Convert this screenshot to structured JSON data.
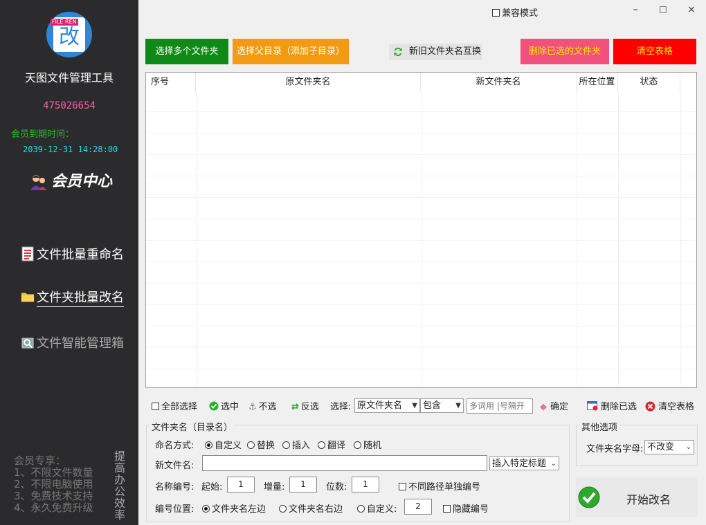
{
  "sidebar": {
    "logo_tag": "FILE REN",
    "logo_char": "改",
    "app_name": "天图文件管理工具",
    "user_id": "475026654",
    "expiry_label": "会员到期时间：",
    "expiry_value": "2039-12-31 14:28:00",
    "member_center": "会员中心",
    "nav": [
      {
        "label": "文件批量重命名",
        "icon": "document-list-icon"
      },
      {
        "label": "文件夹批量改名",
        "icon": "folder-icon"
      },
      {
        "label": "文件智能管理箱",
        "icon": "magnifier-box-icon"
      }
    ],
    "perks_title": "会员专享：",
    "perks": [
      "1、不限文件数量",
      "2、不限电脑使用",
      "3、免费技术支持",
      "4、永久免费升级"
    ],
    "slogan": "提高办公效率"
  },
  "titlebar": {
    "compat_mode": "兼容模式",
    "minimize": "–",
    "maximize": "□",
    "close": "×"
  },
  "actions": {
    "select_folders": "选择多个文件夹",
    "select_parent": "选择父目录（添加子目录）",
    "swap_names": "新旧文件夹名互换",
    "delete_selected_folders": "删除已选的文件夹",
    "clear_table": "清空表格"
  },
  "table": {
    "columns": [
      "序号",
      "原文件夹名",
      "新文件夹名",
      "所在位置",
      "状态"
    ],
    "rows": []
  },
  "toolbar": {
    "select_all": "全部选择",
    "check": "选中",
    "uncheck": "不选",
    "invert": "反选",
    "select_label": "选择:",
    "field_value": "原文件夹名",
    "match_value": "包含",
    "keyword_placeholder": "多词用 |号隔开",
    "confirm": "确定",
    "delete_selected": "删除已选",
    "clear_table": "清空表格"
  },
  "rename_group": {
    "title": "文件夹名（目录名）",
    "mode_label": "命名方式:",
    "modes": [
      "自定义",
      "替换",
      "插入",
      "翻译",
      "随机"
    ],
    "new_name_label": "新文件名:",
    "new_name_value": "",
    "insert_title": "插入特定标题",
    "numbering_label": "名称编号:",
    "start_label": "起始:",
    "start_value": "1",
    "step_label": "增量:",
    "step_value": "1",
    "digits_label": "位数:",
    "digits_value": "1",
    "separate_path": "不同路径单独编号",
    "position_label": "编号位置:",
    "positions": [
      "文件夹名左边",
      "文件夹名右边",
      "自定义:"
    ],
    "custom_pos_value": "2",
    "hide_number": "隐藏编号"
  },
  "other_group": {
    "title": "其他选项",
    "letter_label": "文件夹名字母:",
    "letter_value": "不改变"
  },
  "start_button": "开始改名",
  "colors": {
    "sidebar_bg": "#2b2b2d",
    "green_btn": "#0f8a16",
    "orange_btn": "#f19a12",
    "pink_btn": "#f2507d",
    "red_btn": "#ff0000"
  }
}
